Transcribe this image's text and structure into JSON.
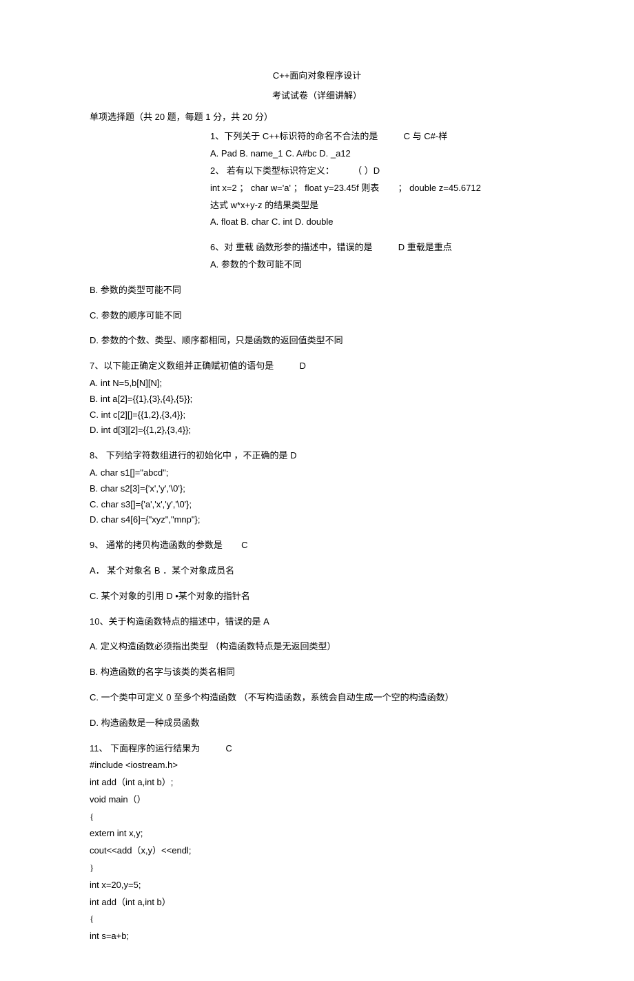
{
  "title": "C++面向对象程序设计",
  "subtitle": "考试试卷（详细讲解）",
  "section_header": "单项选择题（共 20 题，每题 1 分，共 20 分）",
  "q1": {
    "text": "1、下列关于 C++标识符的命名不合法的是",
    "ans": "C 与 C#-样",
    "opts": "A. Pad B. name_1 C. A#bc D. _a12"
  },
  "q2": {
    "text_a": "2、 若有以下类型标识符定义：",
    "paren": "（  ）D",
    "code": "int x=2 ； char w='a' ； float y=23.45f 则表",
    "code_tail": "； double z=45.6712",
    "expr": "达式 w*x+y-z 的结果类型是",
    "opts": "A. float B. char C. int D. double"
  },
  "q6": {
    "text": "6、对 重载 函数形参的描述中，错误的是",
    "ans": "D 重载是重点",
    "optA": "A. 参数的个数可能不同",
    "optB": "B.  参数的类型可能不同",
    "optC": "C.  参数的顺序可能不同",
    "optD": "D.  参数的个数、类型、顺序都相同，只是函数的返回值类型不同"
  },
  "q7": {
    "text": "7、以下能正确定义数组并正确赋初值的语句是",
    "ans": "D",
    "optA": "A.   int N=5,b[N][N];",
    "optB": "B.   int a[2]={{1},{3},{4},{5}};",
    "optC": "C.   int c[2][]={{1,2},{3,4}};",
    "optD": "D.   int d[3][2]={{1,2},{3,4}};"
  },
  "q8": {
    "text": "8、 下列给字符数组进行的初始化中  ，不正确的是  D",
    "optA": "A.   char s1[]=\"abcd\";",
    "optB": "B.   char s2[3]={'x','y','\\0'};",
    "optC": "C.   char s3[]={'a','x','y','\\0'};",
    "optD": "D.   char s4[6]={\"xyz\",\"mnp\"};"
  },
  "q9": {
    "text": "9、 通常的拷贝构造函数的参数是",
    "ans": "C",
    "lineAB": "A． 某个对象名 B ．某个对象成员名",
    "lineCD": "C. 某个对象的引用 D •某个对象的指针名"
  },
  "q10": {
    "text": "10、关于构造函数特点的描述中，错误的是  A",
    "optA": "A.  定义构造函数必须指出类型 （构造函数特点是无返回类型）",
    "optB": "B.  构造函数的名字与该类的类名相同",
    "optC": "C.  一个类中可定义 0 至多个构造函数 （不写构造函数，系统会自动生成一个空的构造函数）",
    "optD": "D.  构造函数是一种成员函数"
  },
  "q11": {
    "text": "11、 下面程序的运行结果为",
    "ans": "C",
    "code": [
      "#include <iostream.h>",
      "int add（int a,int b）;",
      "void main（）",
      "{",
      "extern int x,y;",
      "cout<<add（x,y）<<endl;",
      "}",
      "int x=20,y=5;",
      "int add（int a,int b）",
      "{",
      "int s=a+b;"
    ]
  }
}
